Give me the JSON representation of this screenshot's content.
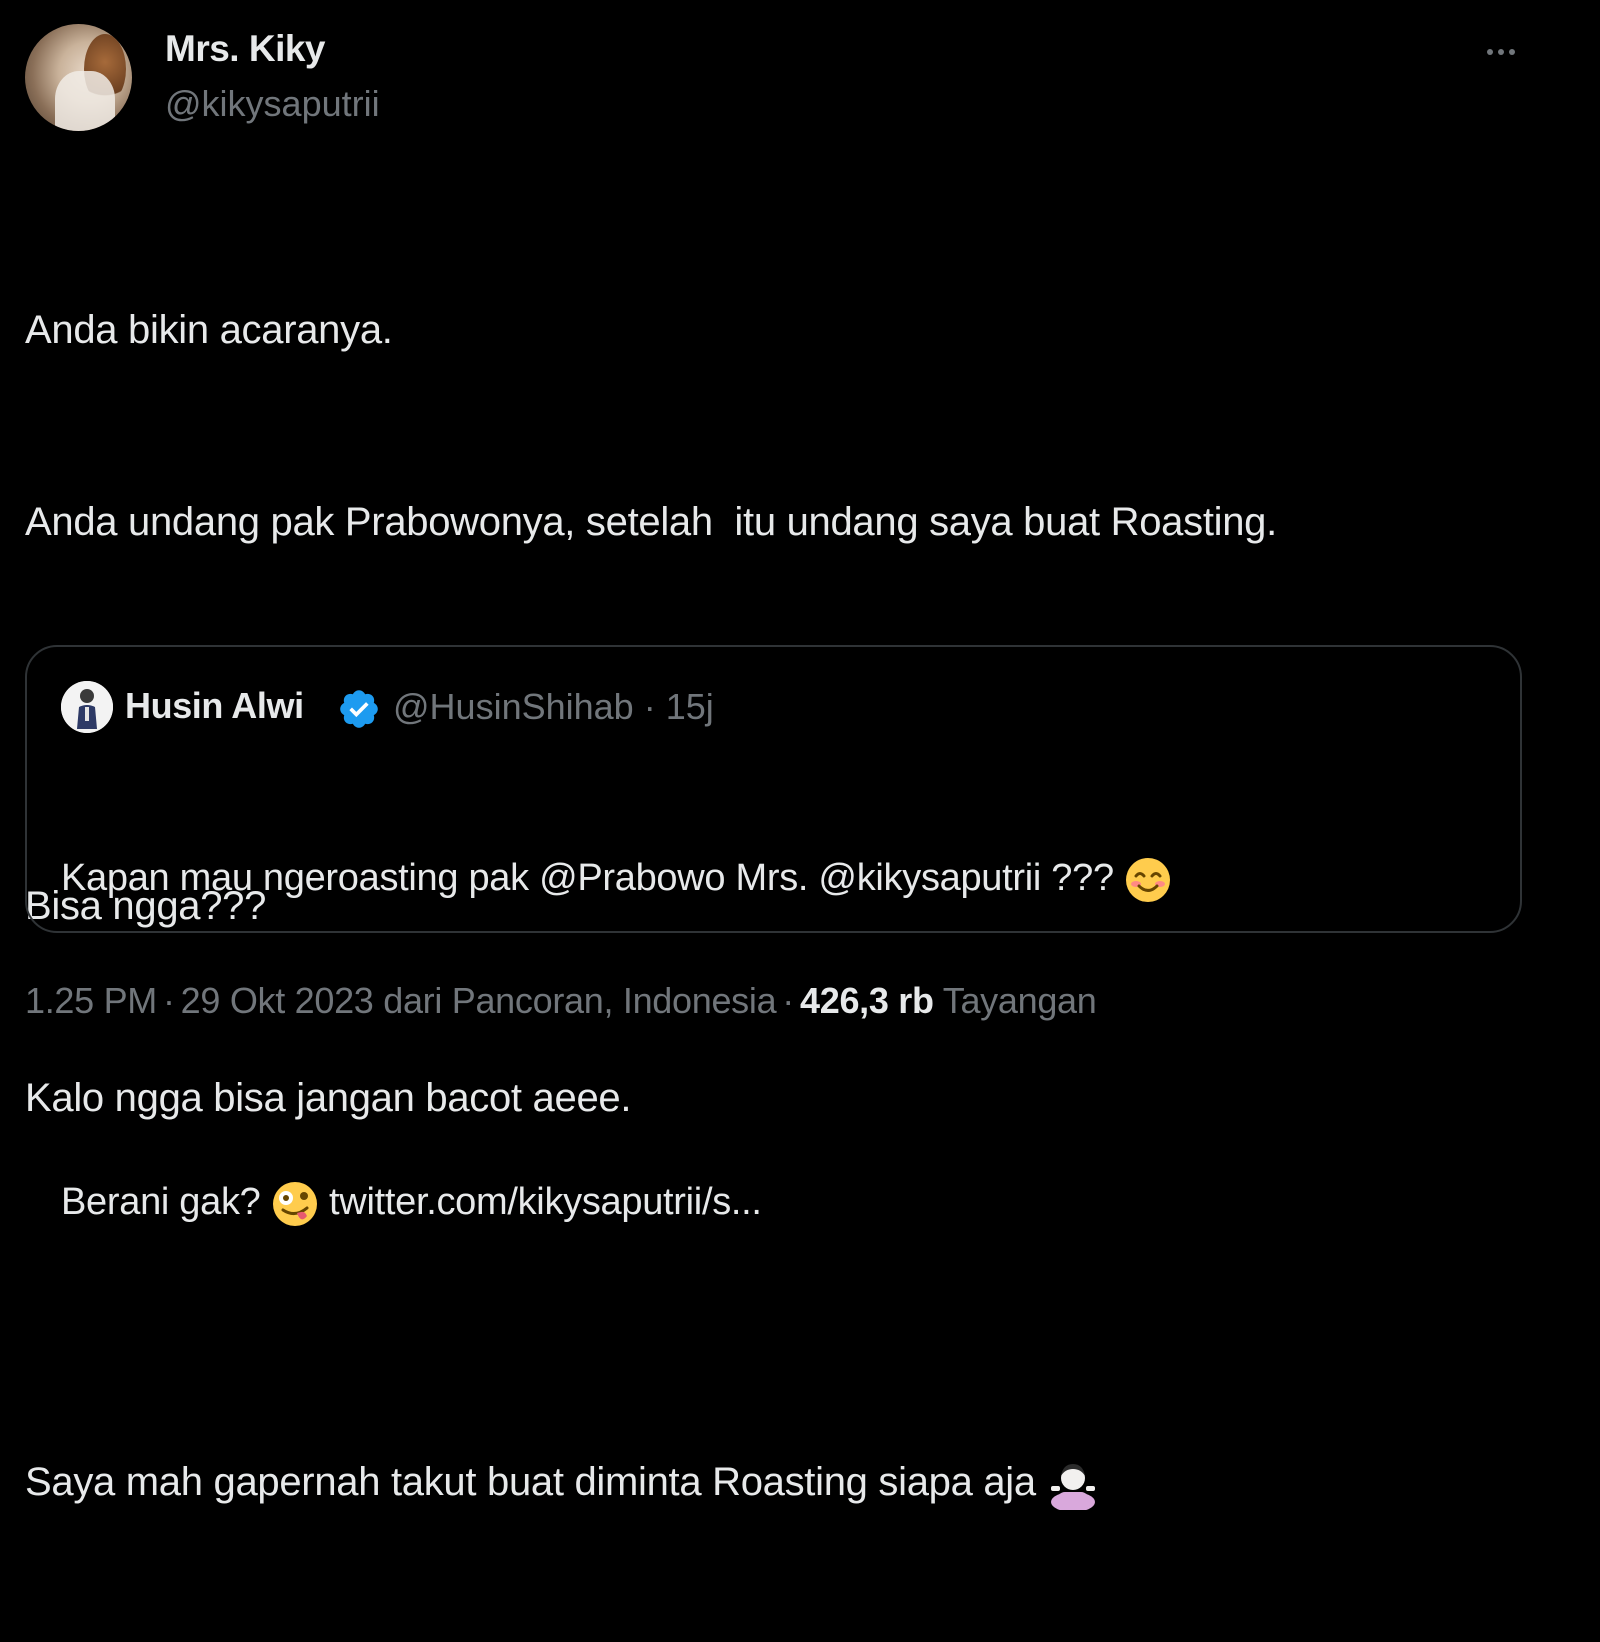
{
  "author": {
    "display_name": "Mrs. Kiky",
    "handle": "@kikysaputrii"
  },
  "tweet": {
    "lines": [
      "Anda bikin acaranya.",
      "Anda undang pak Prabowonya, setelah  itu undang saya buat Roasting.",
      "",
      "Bisa ngga???",
      "Kalo ngga bisa jangan bacot aeee.",
      "",
      "Saya mah gapernah takut buat diminta Roasting siapa aja"
    ],
    "trailing_emoji_icon": "person-shrugging-emoji"
  },
  "quote": {
    "display_name": "Husin Alwi",
    "handle": "@HusinShihab",
    "time_ago": "15j",
    "verified_icon": "verified-badge-icon",
    "line1": "Kapan mau ngeroasting pak @Prabowo Mrs. @kikysaputrii ???",
    "line1_emoji_icon": "smiling-face-emoji",
    "line2_prefix": "Berani gak?",
    "line2_emoji_icon": "zany-face-emoji",
    "line2_link": "twitter.com/kikysaputrii/s..."
  },
  "footer": {
    "time": "1.25 PM",
    "date": "29 Okt 2023",
    "location": "dari Pancoran, Indonesia",
    "views_count": "426,3 rb",
    "views_label": "Tayangan"
  },
  "colors": {
    "background": "#000000",
    "text_primary": "#e7e9ea",
    "text_secondary": "#71767b",
    "border": "#2f3336",
    "verified": "#1d9bf0"
  }
}
